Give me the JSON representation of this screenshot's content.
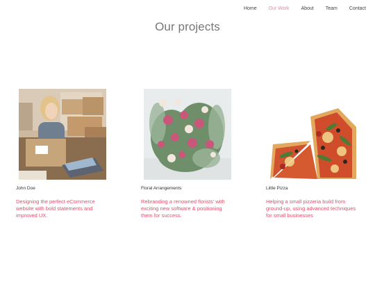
{
  "nav": {
    "items": [
      {
        "label": "Home",
        "active": false
      },
      {
        "label": "Our Work",
        "active": true
      },
      {
        "label": "About",
        "active": false
      },
      {
        "label": "Team",
        "active": false
      },
      {
        "label": "Contact",
        "active": false
      }
    ],
    "active_color": "#e8899d"
  },
  "page": {
    "title": "Our projects"
  },
  "projects": [
    {
      "name": "John Doe",
      "description": "Designing the perfect eCommerce website with bold statements and improved UX.",
      "image": "woman-packing-boxes-laptop"
    },
    {
      "name": "Floral Arrangements",
      "description": "Rebranding a renowned florists' with exciting new software & positioning them for success.",
      "image": "flower-bouquet"
    },
    {
      "name": "Little Pizza",
      "description": "Helping a small pizzeria build from ground-up, using advanced techniques for small businesses",
      "image": "pizza-slices"
    }
  ],
  "colors": {
    "accent": "#e0506c",
    "title": "#777777"
  }
}
